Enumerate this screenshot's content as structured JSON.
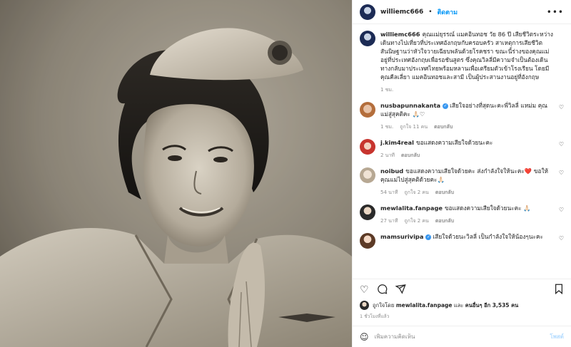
{
  "post": {
    "username": "williemc666",
    "separator": "•",
    "follow_label": "ติดตาม",
    "more_icon": "more-horizontal-icon"
  },
  "caption": {
    "username": "williemc666",
    "text": "คุณแม่ยุรรณ์ แมคอินทอช วัย 86 ปี เสียชีวิตระหว่างเดินทางไปเที่ยวที่ประเทศอังกฤษกับครอบครัว สาเหตุการเสียชีวิต สันนิษฐานว่าหัวใจวายเฉียบพลันด้วยโรคชรา ขณะนี้ร่างของคุณแม่อยู่ที่ประเทศอังกฤษเพื่อรอชันสูตร ซึ่งคุณวิลลี่มีความจำเป็นต้องเดินทางกลับมาประเทศไทยพร้อมหลานเพื่อเตรียมตัวเข้าโรงเรียน โดยมีคุณคีลเลี่ยา แมคอินทอชและสามี เป็นผู้ประสานงานอยู่ที่อังกฤษ",
    "time": "1 ชม."
  },
  "comments": [
    {
      "username": "nusbapunnakanta",
      "verified": true,
      "text": "เสียใจอย่างที่สุดนะคะพี่วิลลี่ แหม่ม คุณแม่สู่สุคติคะ 🙏🏻♡",
      "time": "1 ชม.",
      "likes": "ถูกใจ 11 คน",
      "reply": "ตอบกลับ"
    },
    {
      "username": "j.kim4real",
      "verified": false,
      "text": "ขอแสดงความเสียใจด้วยนะคะ",
      "time": "2 นาที",
      "likes": "",
      "reply": "ตอบกลับ"
    },
    {
      "username": "noibud",
      "verified": false,
      "text": "ขอแสดงความเสียใจด้วยคะ ส่งกำลังใจให้นะคะ❤️ ขอให้คุณแม่ไปสู่สุคติด้วยคะ🙏🏻",
      "time": "54 นาที",
      "likes": "ถูกใจ 2 คน",
      "reply": "ตอบกลับ"
    },
    {
      "username": "mewlalita.fanpage",
      "verified": false,
      "text": "ขอแสดงความเสียใจด้วยนะคะ 🙏🏻",
      "time": "27 นาที",
      "likes": "ถูกใจ 2 คน",
      "reply": "ตอบกลับ"
    },
    {
      "username": "mamsurivipa",
      "verified": true,
      "text": "เสียใจด้วยนะวิลลี่ เป็นกำลังใจให้น้องๆนะคะ",
      "time": "",
      "likes": "",
      "reply": ""
    }
  ],
  "actions": {
    "icons": [
      "heart-icon",
      "comment-icon",
      "share-icon",
      "bookmark-icon"
    ],
    "liked_by_prefix": "ถูกใจโดย",
    "liked_by_user": "mewlalita.fanpage",
    "liked_by_and": "และ",
    "liked_by_others": "คนอื่นๆ อีก 3,535 คน",
    "time": "1 ชั่วโมงที่แล้ว"
  },
  "add_comment": {
    "placeholder": "เพิ่มความคิดเห็น",
    "post_label": "โพสต์",
    "emoji_icon": "emoji-icon"
  },
  "colors": {
    "link": "#0095f6",
    "muted": "#8e8e8e",
    "text": "#262626",
    "like_red": "#ed4956"
  }
}
